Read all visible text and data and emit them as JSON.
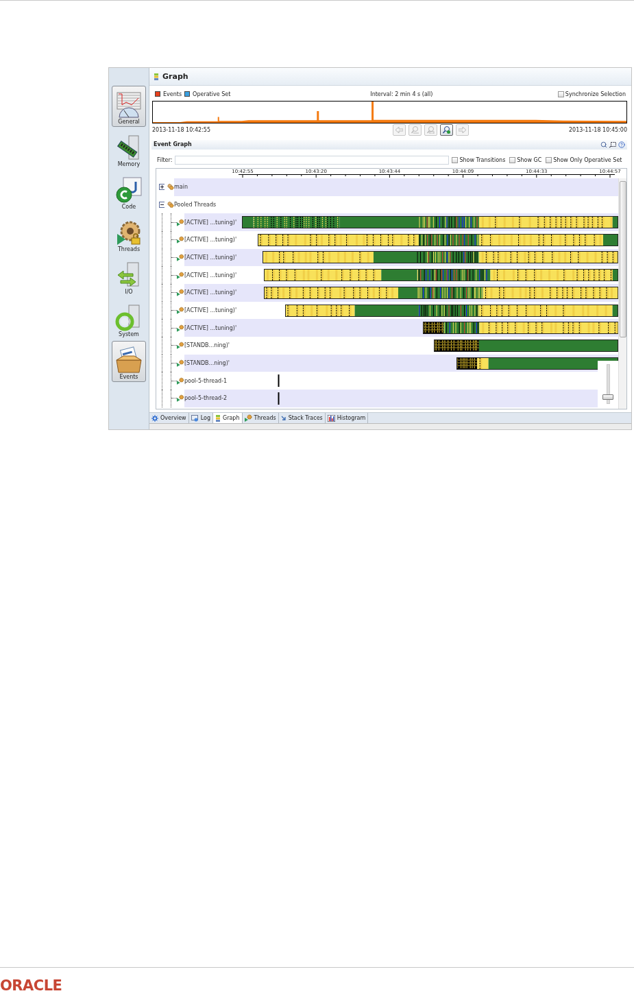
{
  "app": {
    "sidebar": [
      {
        "label": "General",
        "selected": true
      },
      {
        "label": "Memory",
        "selected": false
      },
      {
        "label": "Code",
        "selected": false
      },
      {
        "label": "Threads",
        "selected": false
      },
      {
        "label": "I/O",
        "selected": false
      },
      {
        "label": "System",
        "selected": false
      },
      {
        "label": "Events",
        "selected": true
      }
    ],
    "title": "Graph",
    "overview": {
      "legend": [
        {
          "label": "Events",
          "color": "#e8401c"
        },
        {
          "label": "Operative Set",
          "color": "#3aa0e0"
        }
      ],
      "interval": "Interval: 2 min 4 s (all)",
      "sync": {
        "label": "Synchronize Selection",
        "checked": false
      },
      "start_time": "2013-11-18 10:42:55",
      "end_time": "2013-11-18 10:45:00",
      "nav_buttons": [
        {
          "kind": "back",
          "disabled": true
        },
        {
          "kind": "zoom-out",
          "disabled": true
        },
        {
          "kind": "zoom-selection",
          "disabled": true
        },
        {
          "kind": "zoom-in",
          "disabled": false
        },
        {
          "kind": "forward",
          "disabled": true
        }
      ]
    },
    "event_graph": {
      "title": "Event Graph",
      "filter_label": "Filter:",
      "options": [
        {
          "label": "Show Transitions",
          "checked": false
        },
        {
          "label": "Show GC",
          "checked": false
        },
        {
          "label": "Show Only Operative Set",
          "checked": false
        }
      ],
      "time_ticks": [
        "10:42:55",
        "10:43:20",
        "10:43:44",
        "10:44:09",
        "10:44:33",
        "10:44:57"
      ],
      "tree": [
        {
          "label": "main",
          "expanded": false
        },
        {
          "label": "Pooled Threads",
          "expanded": true,
          "children": [
            {
              "label": "[ACTIVE] ...tuning)'"
            },
            {
              "label": "[ACTIVE] ...tuning)'"
            },
            {
              "label": "[ACTIVE] ...tuning)'"
            },
            {
              "label": "[ACTIVE] ...tuning)'"
            },
            {
              "label": "[ACTIVE] ...tuning)'"
            },
            {
              "label": "[ACTIVE] ...tuning)'"
            },
            {
              "label": "[ACTIVE] ...tuning)'"
            },
            {
              "label": "[STANDB...ning)'"
            },
            {
              "label": "[STANDB...ning)'"
            },
            {
              "label": "pool-5-thread-1"
            },
            {
              "label": "pool-5-thread-2"
            }
          ]
        }
      ],
      "zoom_slider": {
        "level": 0.15
      }
    },
    "tabs": [
      {
        "label": "Overview",
        "selected": false
      },
      {
        "label": "Log",
        "selected": false
      },
      {
        "label": "Graph",
        "selected": true
      },
      {
        "label": "Threads",
        "selected": false
      },
      {
        "label": "Stack Traces",
        "selected": false
      },
      {
        "label": "Histogram",
        "selected": false
      }
    ]
  },
  "footer": {
    "logo": "ORACLE"
  }
}
